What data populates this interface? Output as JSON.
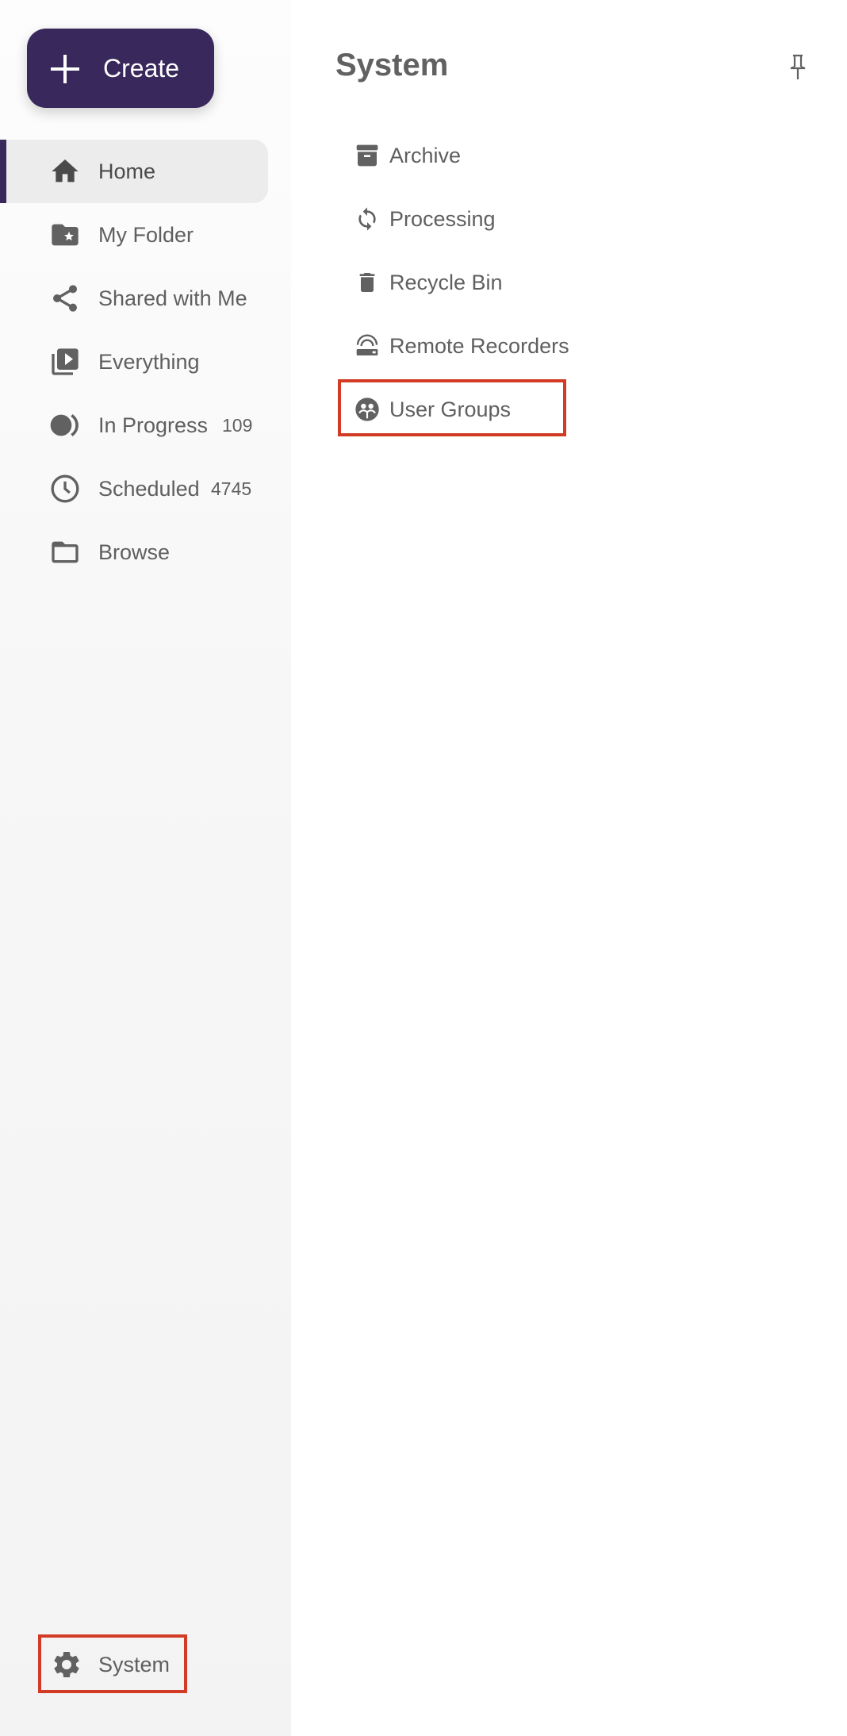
{
  "sidebar": {
    "create_label": "Create",
    "items": [
      {
        "label": "Home",
        "icon": "home-icon",
        "active": true
      },
      {
        "label": "My Folder",
        "icon": "folder-star-icon"
      },
      {
        "label": "Shared with Me",
        "icon": "share-icon"
      },
      {
        "label": "Everything",
        "icon": "video-library-icon"
      },
      {
        "label": "In Progress",
        "icon": "in-progress-icon",
        "count": "109"
      },
      {
        "label": "Scheduled",
        "icon": "clock-icon",
        "count": "4745"
      },
      {
        "label": "Browse",
        "icon": "folder-outline-icon"
      }
    ],
    "system_label": "System"
  },
  "panel": {
    "title": "System",
    "pin_icon": "pin-icon",
    "items": [
      {
        "label": "Archive",
        "icon": "archive-icon"
      },
      {
        "label": "Processing",
        "icon": "sync-icon"
      },
      {
        "label": "Recycle Bin",
        "icon": "trash-icon"
      },
      {
        "label": "Remote Recorders",
        "icon": "remote-recorder-icon"
      },
      {
        "label": "User Groups",
        "icon": "user-groups-icon",
        "highlighted": true
      }
    ]
  },
  "colors": {
    "brand": "#38285b",
    "highlight": "#d23b25",
    "text": "#5f5f5f"
  }
}
